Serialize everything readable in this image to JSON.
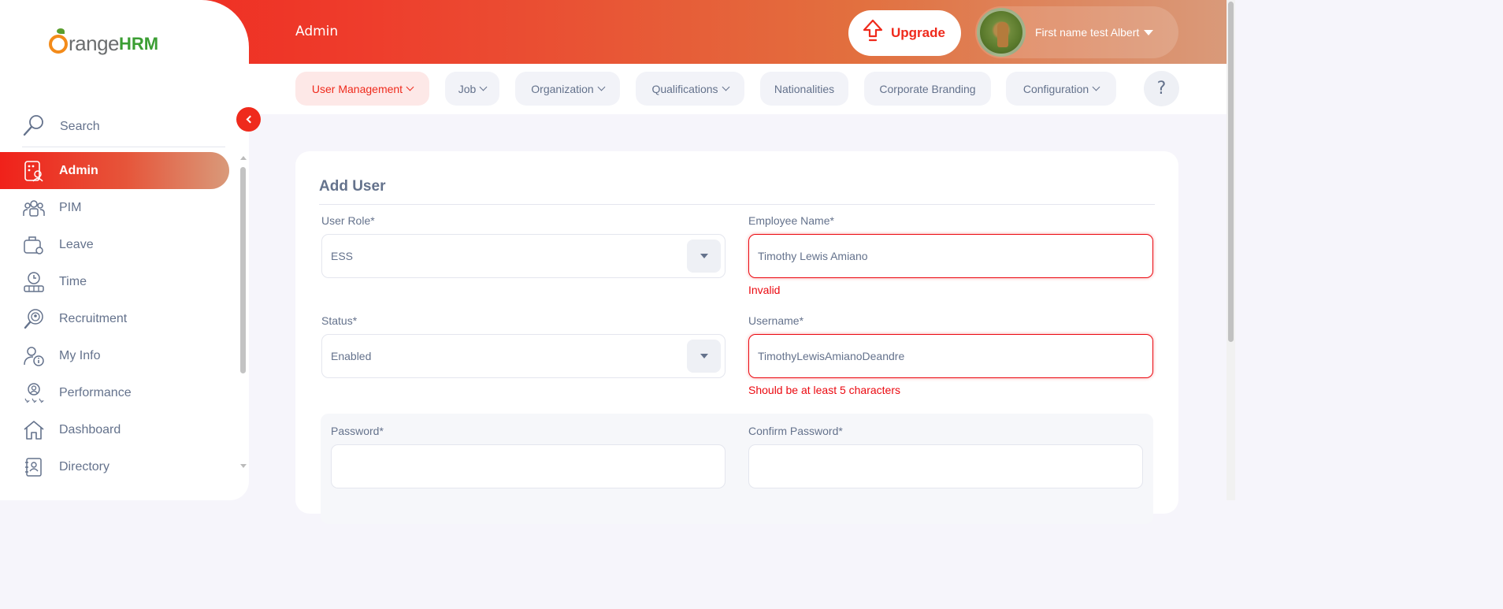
{
  "header": {
    "module_title": "Admin",
    "upgrade_label": "Upgrade",
    "user_name": "First name test Albert"
  },
  "sidebar": {
    "logo_text": "range",
    "logo_suffix": "HRM",
    "search_label": "Search",
    "items": [
      {
        "label": "Admin",
        "icon": "admin-icon",
        "active": true
      },
      {
        "label": "PIM",
        "icon": "pim-icon"
      },
      {
        "label": "Leave",
        "icon": "leave-icon"
      },
      {
        "label": "Time",
        "icon": "time-icon"
      },
      {
        "label": "Recruitment",
        "icon": "recruitment-icon"
      },
      {
        "label": "My Info",
        "icon": "my-info-icon"
      },
      {
        "label": "Performance",
        "icon": "performance-icon"
      },
      {
        "label": "Dashboard",
        "icon": "dashboard-icon"
      },
      {
        "label": "Directory",
        "icon": "directory-icon"
      }
    ]
  },
  "subnav": {
    "items": [
      {
        "label": "User Management",
        "dropdown": true,
        "active": true
      },
      {
        "label": "Job",
        "dropdown": true
      },
      {
        "label": "Organization",
        "dropdown": true
      },
      {
        "label": "Qualifications",
        "dropdown": true
      },
      {
        "label": "Nationalities",
        "dropdown": false
      },
      {
        "label": "Corporate Branding",
        "dropdown": false
      },
      {
        "label": "Configuration",
        "dropdown": true
      }
    ],
    "help_label": "?"
  },
  "form": {
    "title": "Add User",
    "user_role": {
      "label": "User Role*",
      "value": "ESS"
    },
    "employee_name": {
      "label": "Employee Name*",
      "value": "Timothy Lewis Amiano",
      "error": "Invalid"
    },
    "status": {
      "label": "Status*",
      "value": "Enabled"
    },
    "username": {
      "label": "Username*",
      "value": "TimothyLewisAmianoDeandre",
      "error": "Should be at least 5 characters"
    },
    "password": {
      "label": "Password*",
      "value": ""
    },
    "confirm_password": {
      "label": "Confirm Password*",
      "value": ""
    }
  },
  "colors": {
    "accent": "#ef2a1c",
    "error": "#eb0910",
    "text": "#64728c"
  }
}
